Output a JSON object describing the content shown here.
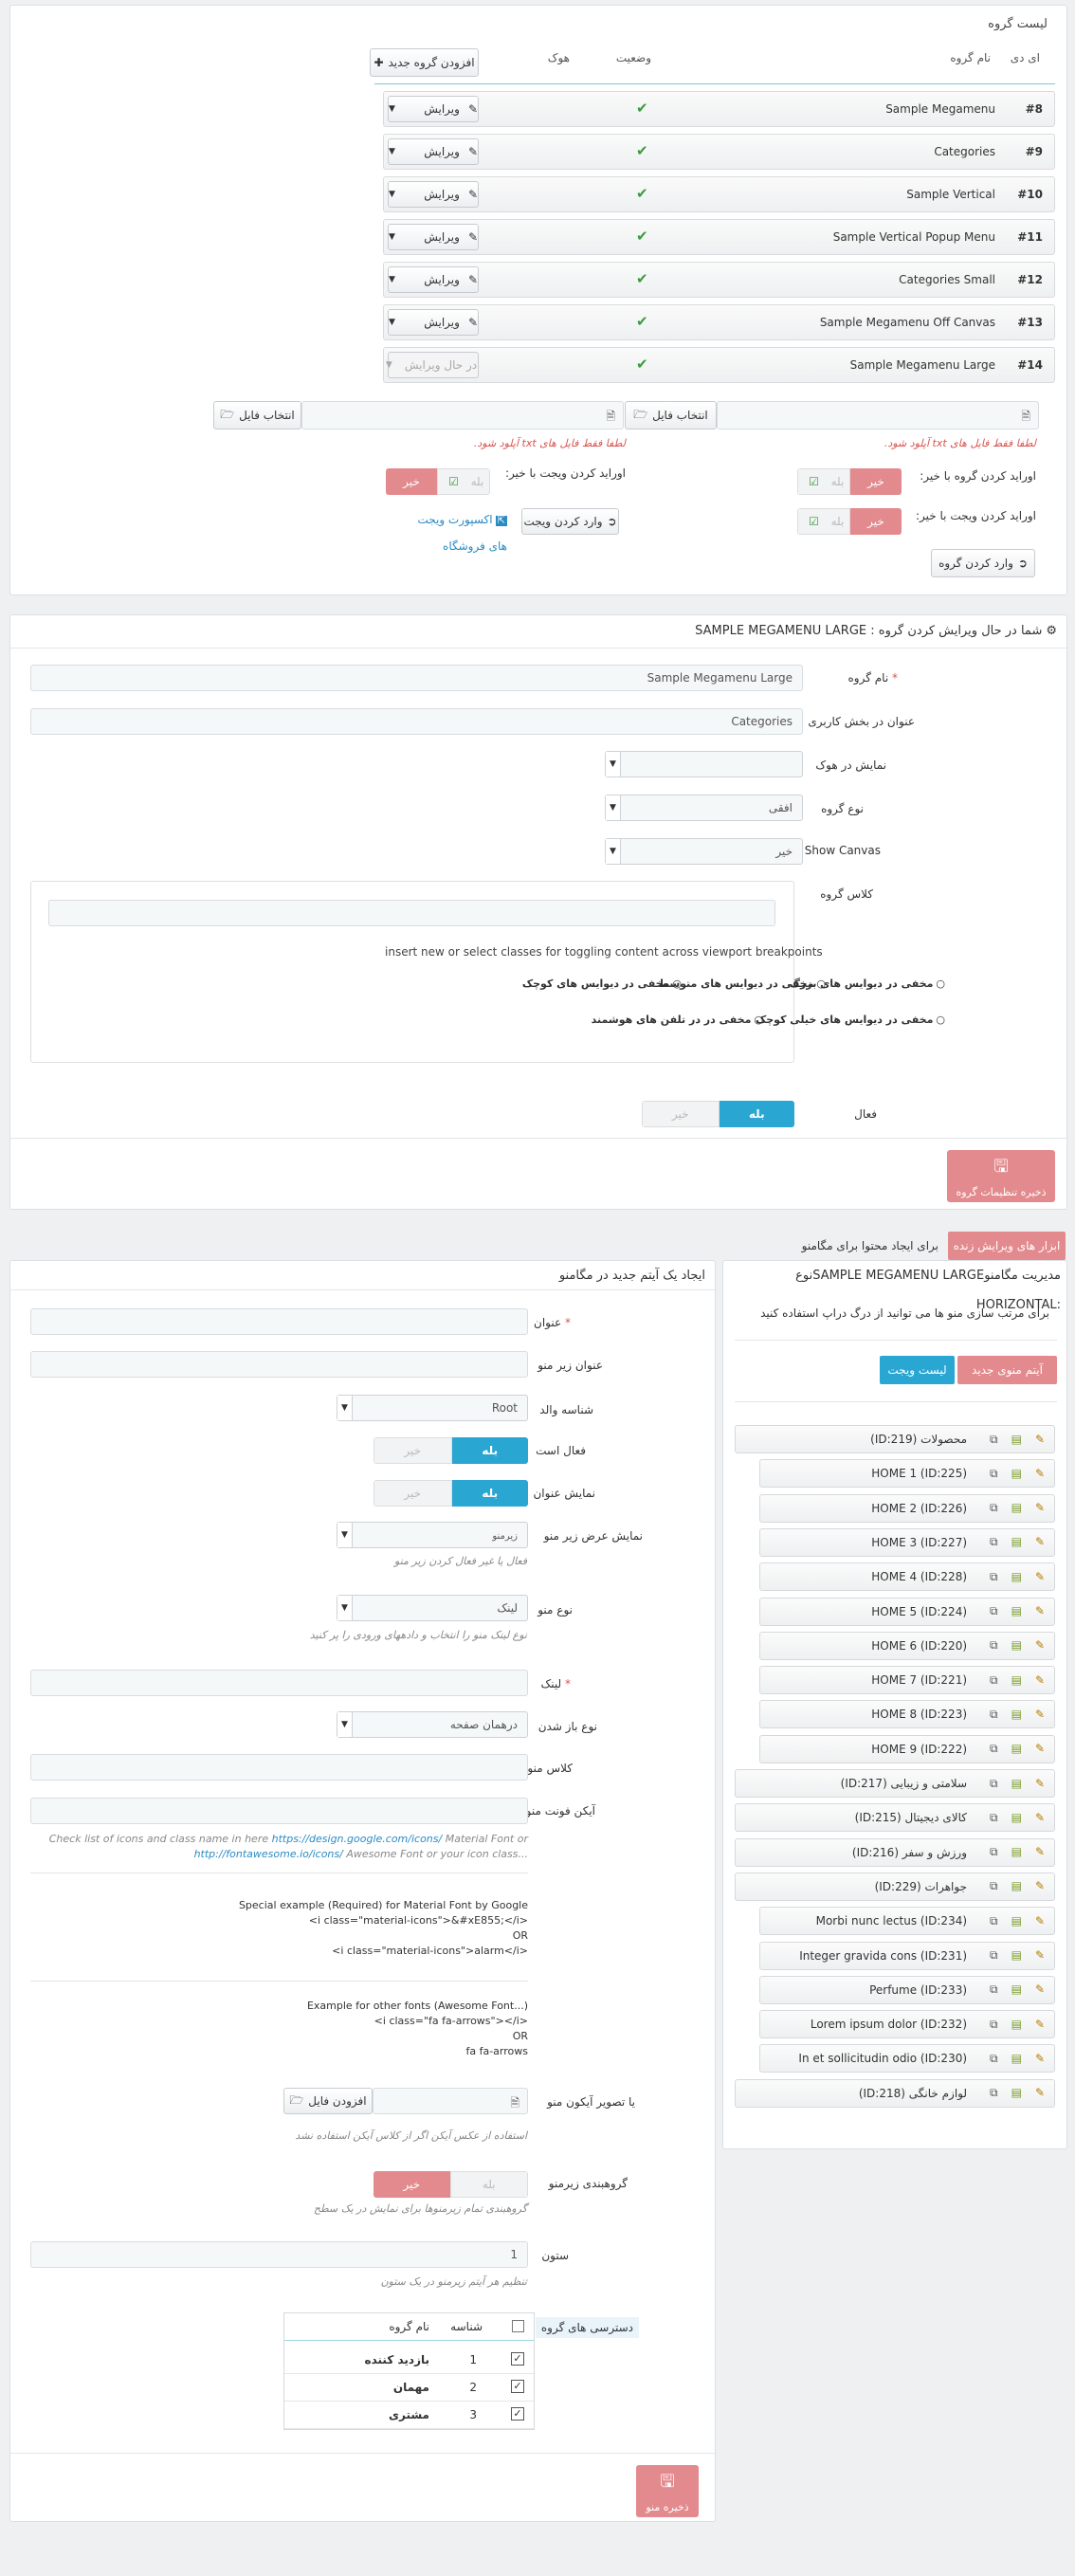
{
  "list_panel": {
    "title": "لیست گروه",
    "headers": {
      "id": "ای دی",
      "name": "نام گروه",
      "status": "وضعیت",
      "hook": "هوک"
    },
    "add_group": "افزودن گروه جدید",
    "groups": [
      {
        "id": "#8",
        "name": "Sample Megamenu",
        "action": "ویرایش"
      },
      {
        "id": "#9",
        "name": "Categories",
        "action": "ویرایش"
      },
      {
        "id": "#10",
        "name": "Sample Vertical",
        "action": "ویرایش"
      },
      {
        "id": "#11",
        "name": "Sample Vertical Popup Menu",
        "action": "ویرایش"
      },
      {
        "id": "#12",
        "name": "Categories Small",
        "action": "ویرایش"
      },
      {
        "id": "#13",
        "name": "Sample Megamenu Off Canvas",
        "action": "ویرایش"
      },
      {
        "id": "#14",
        "name": "Sample Megamenu Large",
        "action": "در حال ویرایش"
      }
    ],
    "choose_file": "انتخاب فایل",
    "txt_note": "لطفا فقط فایل های txt آپلود شود.",
    "override_group": "اوراید کردن گروه با خیر:",
    "override_widget": "اوراید کردن ویجت با خیر:",
    "yes": "بله",
    "no": "خیر",
    "import_group": "وارد کردن گروه",
    "import_widget": "وارد کردن ویجت",
    "export_widget": "اکسپورت ویجت",
    "shop_widgets": "های فروشگاه"
  },
  "edit_panel": {
    "title": "شما در حال ویرایش کردن گروه : SAMPLE MEGAMENU LARGE",
    "group_name_label": "نام گروه",
    "group_name": "Sample Megamenu Large",
    "user_title_label": "عنوان در بخش کاربری",
    "user_title": "Categories",
    "hook_label": "نمایش در هوک",
    "type_label": "نوع گروه",
    "type_value": "افقی",
    "canvas_label": "Show Canvas",
    "canvas_value": "خیر",
    "class_label": "کلاس گروه",
    "class_help": "insert new or select classes for toggling content across viewport breakpoints",
    "radios": [
      "مخفی در دیوایس های بزرگ",
      "مخفی در دیوایس های متوسط",
      "مخفی در دیوایس های کوچک",
      "مخفی در دیوایس های خیلی کوچک",
      "مخفی در در تلفن های هوشمند"
    ],
    "active_label": "فعال",
    "save": "ذخیره تنظیمات گروه"
  },
  "live_tools": {
    "button": "ابزار های ویرایش زنده",
    "text": "برای ایجاد محتوا برای مگامنو"
  },
  "manage_panel": {
    "title": "مدیریت مگامنوSAMPLE MEGAMENU LARGEنوع",
    "type": "HORIZONTAL:",
    "hint": "برای مرتب سازی منو ها می توانید از درگ دراپ استفاده کنید",
    "new_item": "آیتم منوی جدید",
    "widget_list": "لیست ویجت",
    "items": [
      {
        "label": "محصولات (ID:219)",
        "level": 0
      },
      {
        "label": "HOME 1 (ID:225)",
        "level": 1
      },
      {
        "label": "HOME 2 (ID:226)",
        "level": 1
      },
      {
        "label": "HOME 3 (ID:227)",
        "level": 1
      },
      {
        "label": "HOME 4 (ID:228)",
        "level": 1
      },
      {
        "label": "HOME 5 (ID:224)",
        "level": 1
      },
      {
        "label": "HOME 6 (ID:220)",
        "level": 1
      },
      {
        "label": "HOME 7 (ID:221)",
        "level": 1
      },
      {
        "label": "HOME 8 (ID:223)",
        "level": 1
      },
      {
        "label": "HOME 9 (ID:222)",
        "level": 1
      },
      {
        "label": "سلامتی و زیبایی (ID:217)",
        "level": 0
      },
      {
        "label": "کالای دیجیتال (ID:215)",
        "level": 0
      },
      {
        "label": "ورزش و سفر (ID:216)",
        "level": 0
      },
      {
        "label": "جواهرات (ID:229)",
        "level": 0
      },
      {
        "label": "Morbi nunc lectus (ID:234)",
        "level": 1
      },
      {
        "label": "Integer gravida cons (ID:231)",
        "level": 1
      },
      {
        "label": "Perfume (ID:233)",
        "level": 1
      },
      {
        "label": "Lorem ipsum dolor (ID:232)",
        "level": 1
      },
      {
        "label": "In et sollicitudin odio (ID:230)",
        "level": 1
      },
      {
        "label": "لوازم خانگی (ID:218)",
        "level": 0
      }
    ]
  },
  "new_item_panel": {
    "title": "ایجاد یک آیتم جدید در مگامنو",
    "title_label": "عنوان",
    "subtitle_label": "عنوان زیر منو",
    "parent_label": "شناسه والد",
    "parent_value": "Root",
    "active_label": "فعال است",
    "show_title_label": "نمایش عنوان",
    "submenu_width_label": "نمایش عرض زیر منو",
    "submenu_width_value": "زیرمنو",
    "submenu_width_help": "فعال یا غیر فعال کردن زیر منو",
    "menu_type_label": "نوع منو",
    "menu_type_value": "لینک",
    "menu_type_help": "نوع لینک منو را انتخاب و دادههای ورودی را پر کنید",
    "link_label": "لینک",
    "open_label": "نوع باز شدن",
    "open_value": "درهمان صفحه",
    "class_label": "کلاس منو",
    "icon_font_label": "آیکن فونت منو",
    "icon_help_1a": "Check list of icons and class name in here ",
    "icon_help_link1": "https://design.google.com/icons/",
    "icon_help_1b": " Material Font or",
    "icon_help_link2": "http://fontawesome.io/icons/",
    "icon_help_2b": " Awesome Font or your icon class...",
    "ex1_title": "Special example (Required) for Material Font by Google",
    "ex1_code1": "<i class=\"material-icons\">&#xE855;</i>",
    "ex1_or": "OR",
    "ex1_code2": "<i class=\"material-icons\">alarm</i>",
    "ex2_title": "Example for other fonts (Awesome Font...)",
    "ex2_code1": "<i class=\"fa fa-arrows\"></i>",
    "ex2_or": "OR",
    "ex2_code2": "fa fa-arrows",
    "image_label": "یا تصویر آیکون منو",
    "add_file": "افزودن فایل",
    "image_help": "استفاده از عکس آیکن اگر از کلاس آیکن استفاده نشد",
    "group_sub_label": "گروهبندی زیرمنو",
    "group_sub_help": "گروهبندی تمام زیرمنوها برای نمایش در یک سطح",
    "column_label": "ستون",
    "column_value": "1",
    "column_help": "تنظیم هر آیتم زیرمنو در یک ستون",
    "access_label": "دسترسی های گروه",
    "access_headers": {
      "id": "شناسه",
      "name": "نام گروه"
    },
    "access_rows": [
      {
        "id": "1",
        "name": "بازدید کننده"
      },
      {
        "id": "2",
        "name": "مهمان"
      },
      {
        "id": "3",
        "name": "مشتری"
      }
    ],
    "save": "ذخیره منو",
    "yes": "بله",
    "no": "خیر"
  },
  "colors": {
    "blue": "#29a6d2",
    "red": "#e38a8e",
    "check": "#3a9a3a",
    "link": "#2a8bc4"
  }
}
